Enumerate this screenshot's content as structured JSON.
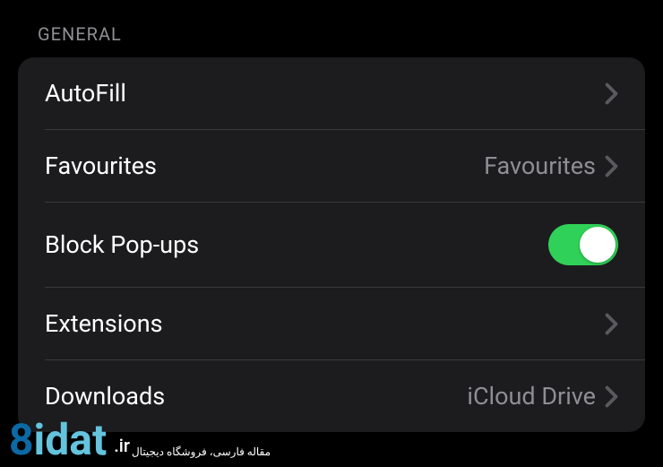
{
  "section": {
    "header": "GENERAL",
    "rows": {
      "autofill": {
        "label": "AutoFill"
      },
      "favourites": {
        "label": "Favourites",
        "value": "Favourites"
      },
      "blockPopups": {
        "label": "Block Pop-ups",
        "toggle": true
      },
      "extensions": {
        "label": "Extensions"
      },
      "downloads": {
        "label": "Downloads",
        "value": "iCloud Drive"
      }
    }
  },
  "watermark": {
    "eight": "8",
    "idat": "idat",
    "ir": ".ir",
    "tagline": "مقاله فارسی، فروشگاه دیجیتال"
  }
}
